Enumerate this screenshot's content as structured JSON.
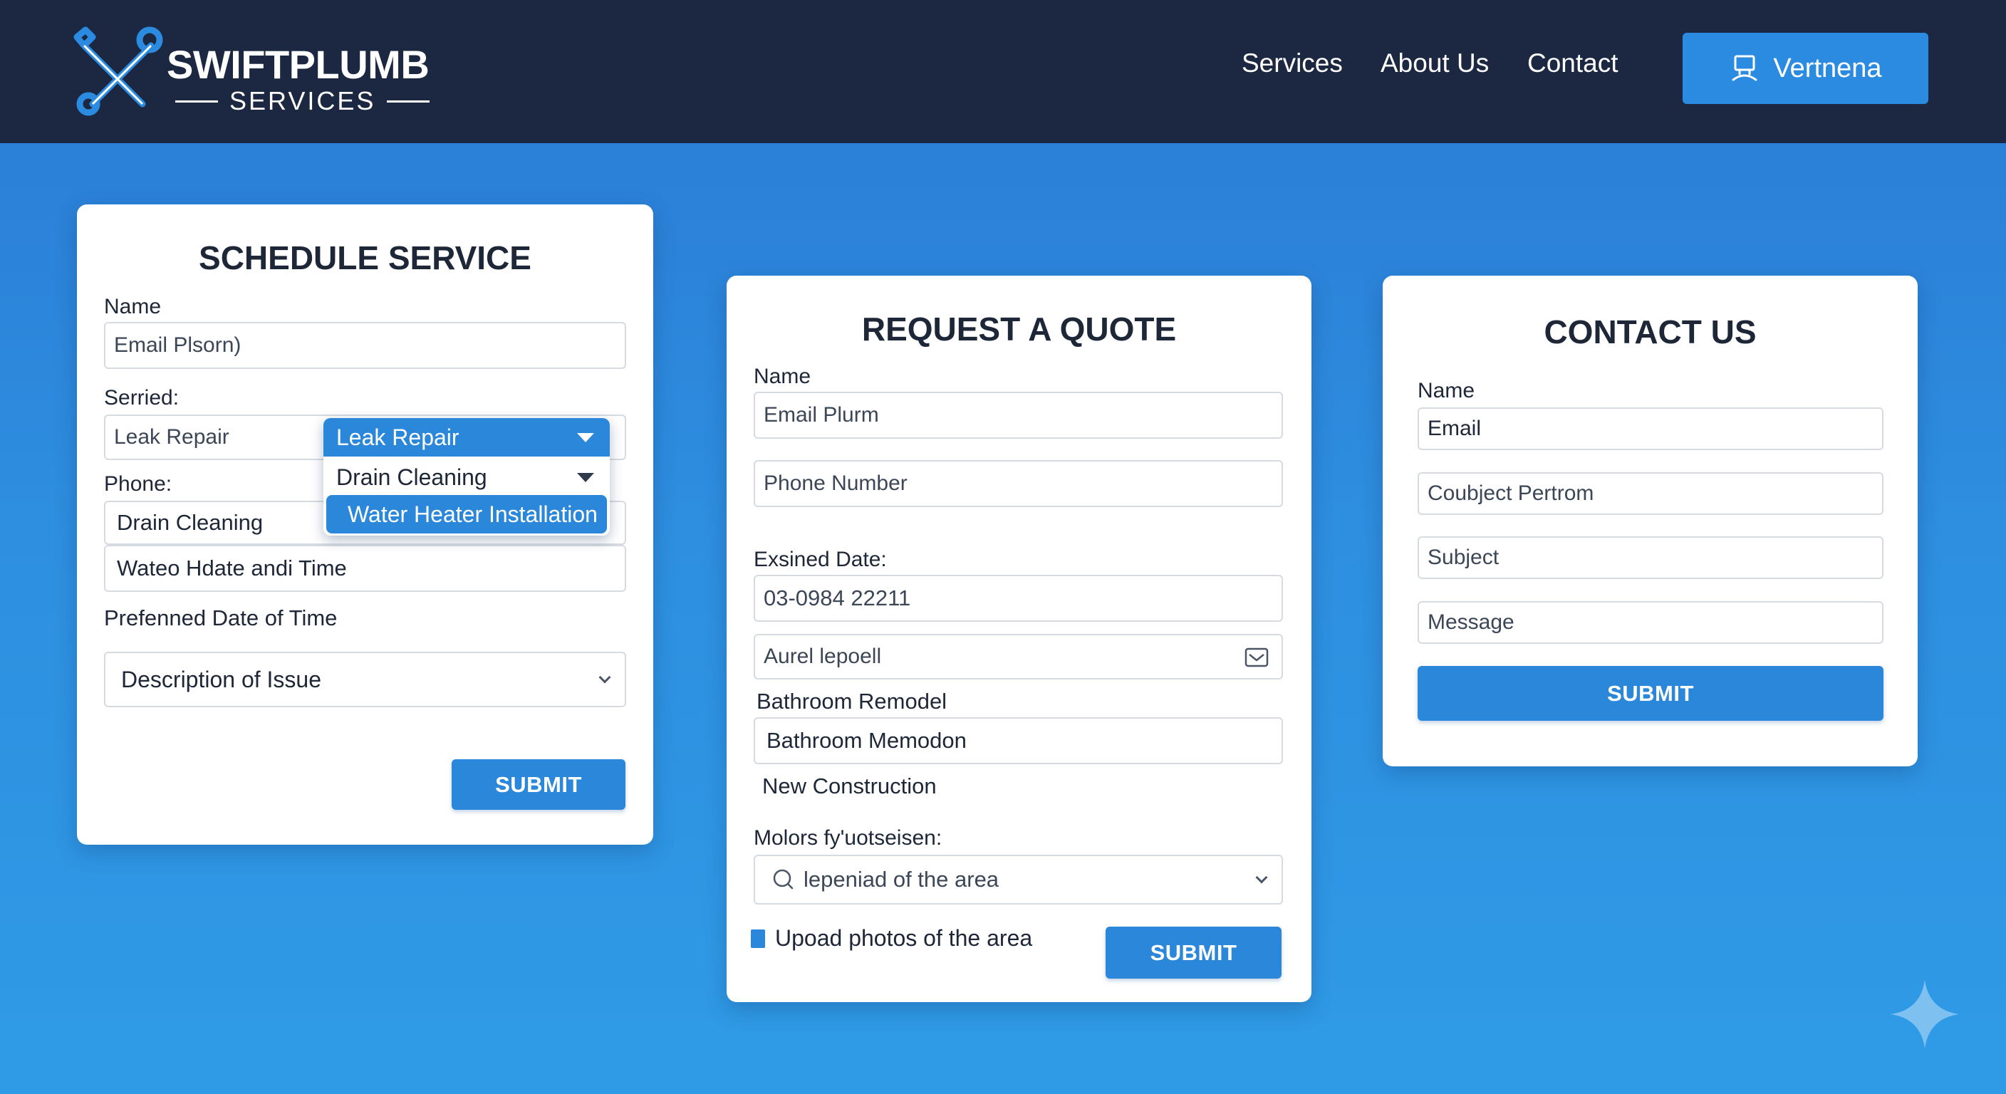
{
  "brand": {
    "name": "SWIFTPLUMB",
    "tagline": "SERVICES",
    "logo_icon": "wrench-cross-icon",
    "colors": {
      "header": "#1c2841",
      "accent": "#2b87d9",
      "background": "#2e8fe0"
    }
  },
  "nav": {
    "links": [
      "Services",
      "About Us",
      "Contact"
    ],
    "cta": {
      "label": "Vertnena",
      "icon": "desktop-user-icon"
    }
  },
  "schedule": {
    "title": "SCHEDULE SERVICE",
    "name_label": "Name",
    "name_value": "Email Plsorn)",
    "service_label": "Serried:",
    "service_value": "Leak Repair",
    "phone_label": "Phone:",
    "phone_value": "Drain Cleaning",
    "date_time_value": "Wateo Hdate andi Time",
    "preferred_label": "Prefenned Date of Time",
    "issue_select": "Description of Issue",
    "submit": "SUBMIT",
    "dropdown": {
      "selected": "Leak Repair",
      "options": [
        "Drain Cleaning",
        "Water Heater Installation"
      ]
    }
  },
  "quote": {
    "title": "REQUEST A QUOTE",
    "name_label": "Name",
    "name_value": "Email Plurm",
    "phone_placeholder": "Phone Number",
    "date_label": "Exsined Date:",
    "date_value": "03-0984 22211",
    "email_value": "Aurel lepoell",
    "email_icon": "envelope-icon",
    "project_label": "Bathroom Remodel",
    "project_value": "Bathroom Memodon",
    "construction_text": "New Construction",
    "motors_label": "Molors fy'uotseisen:",
    "search_select": "lepeniad of the area",
    "search_icon": "search-icon",
    "upload_text": "Upoad photos of the area",
    "submit": "SUBMIT"
  },
  "contact": {
    "title": "CONTACT US",
    "name_label": "Name",
    "email_placeholder": "Email",
    "field2_placeholder": "Coubject Pertrom",
    "subject_placeholder": "Subject",
    "message_placeholder": "Message",
    "submit": "SUBMIT"
  }
}
